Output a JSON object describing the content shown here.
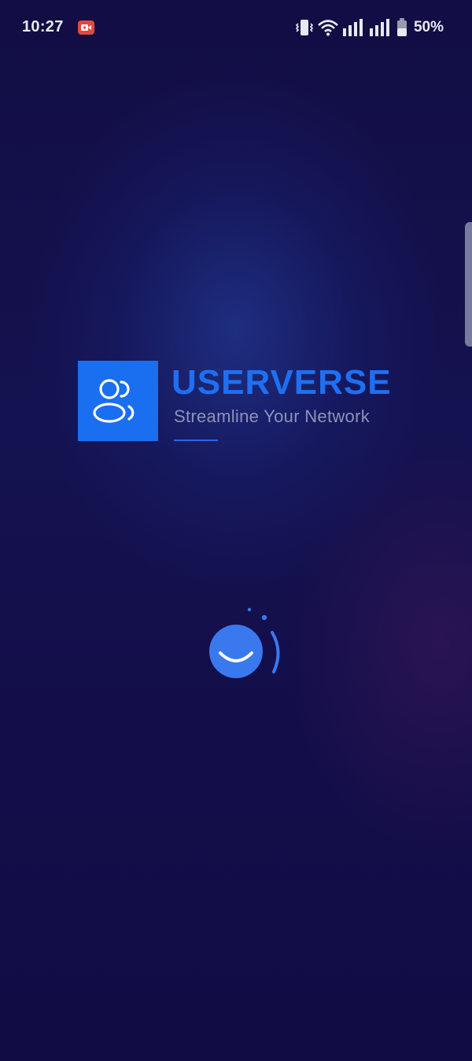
{
  "status_bar": {
    "time": "10:27",
    "battery": "50%",
    "icons": [
      "screen-record-icon",
      "vibrate-icon",
      "wifi-icon",
      "signal-icon",
      "signal-icon",
      "battery-icon"
    ]
  },
  "splash": {
    "app_name": "USERVERSE",
    "tagline": "Streamline Your Network",
    "logo_icon": "users-icon",
    "loader_icon": "smile-loader-icon"
  },
  "colors": {
    "background": "#120d45",
    "brand": "#1a6ef0",
    "tagline": "#8c93b8"
  }
}
